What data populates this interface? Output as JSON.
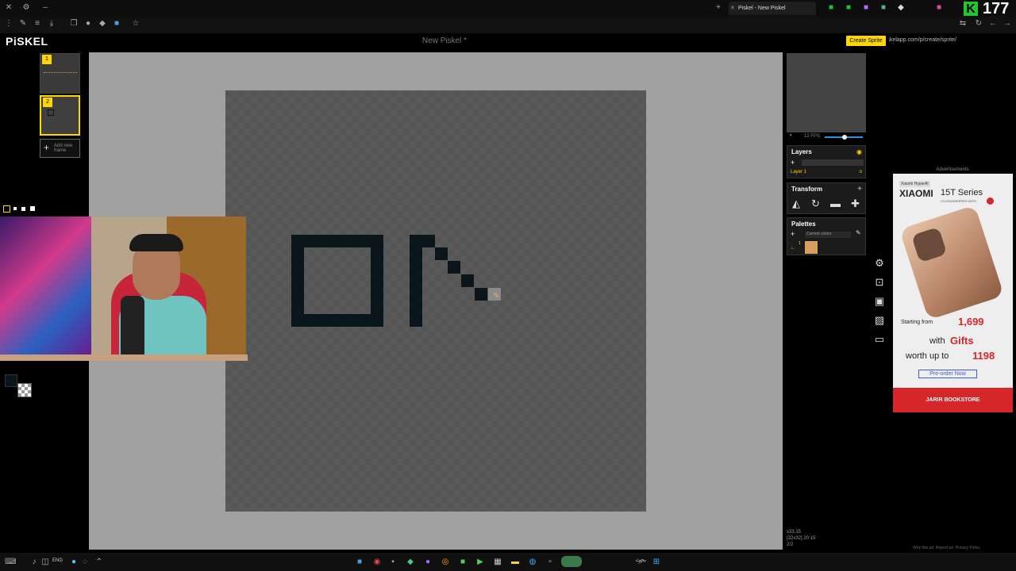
{
  "browser": {
    "tab_title": "Piskel - New Piskel",
    "url": "piskelapp.com/p/create/sprite/",
    "overlay_counter": "177"
  },
  "app": {
    "logo": "PiSKEL",
    "document_title": "New Piskel *",
    "create_button": "Create Sprite"
  },
  "frames": {
    "items": [
      {
        "number": "1"
      },
      {
        "number": "2"
      }
    ],
    "add_frame_label": "Add new frame"
  },
  "right_panel": {
    "fps": "12 FPS",
    "layers": {
      "title": "Layers",
      "layer_name": "Layer 1",
      "layer_opacity": "o"
    },
    "transform": {
      "title": "Transform"
    },
    "palettes": {
      "title": "Palettes",
      "selected": "Current colors",
      "color_count": "1"
    }
  },
  "status": {
    "coords": "x33.15",
    "size_info": "[32x32] 20:15",
    "frame_info": "2/2"
  },
  "ad": {
    "header": "Advertisements",
    "badge": "Xiaomi HyperAI",
    "brand": "XIAOMI",
    "model": "15T Series",
    "co_engineered": "CO-ENGINEERED WITH",
    "price_prefix": "Starting from",
    "price": "1,699",
    "gifts_prefix": "with",
    "gifts": "Gifts",
    "worth_prefix": "worth up to",
    "worth_value": "1198",
    "cta": "Pre-order Now",
    "store": "JARIR BOOKSTORE",
    "links": [
      "Why this ad",
      "Report ad",
      "Privacy Policy"
    ]
  },
  "taskbar": {
    "language": "ENG",
    "search_placeholder": "بحث"
  },
  "colors": {
    "accent": "#ffd700",
    "canvas_bg": "#555555",
    "stage_bg": "#a0a0a0",
    "pixel_color": "#0a151c",
    "ad_red": "#d7262a"
  }
}
